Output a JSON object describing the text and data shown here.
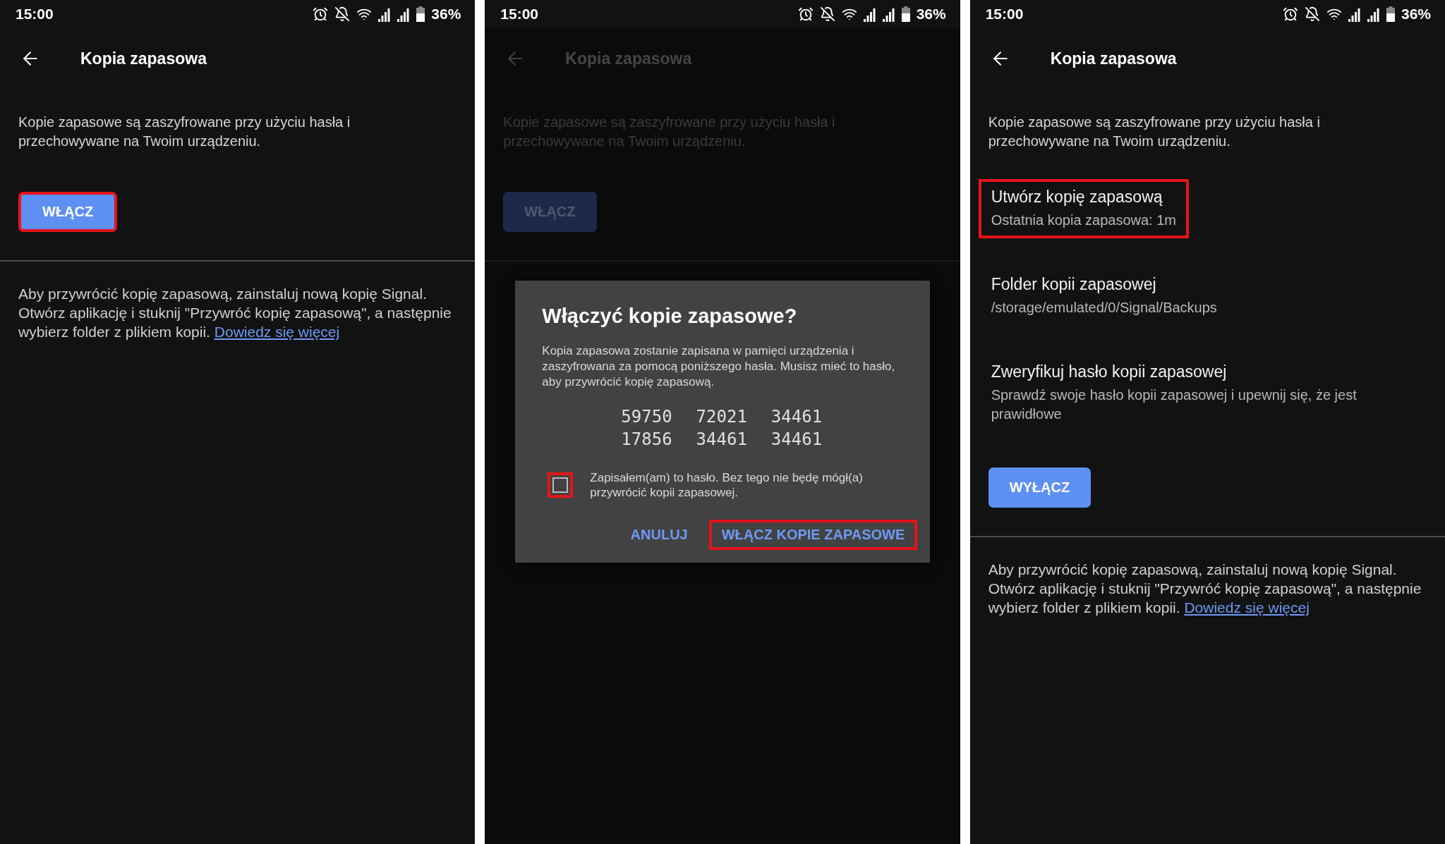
{
  "panels": [
    {
      "status_bar": {
        "time": "15:00",
        "battery": "36%"
      },
      "header": {
        "title": "Kopia zapasowa"
      },
      "dimmed": false,
      "items": [
        {
          "kind": "text",
          "text": "Kopie zapasowe są zaszyfrowane przy użyciu hasła i przechowywane na Twoim urządzeniu."
        },
        {
          "kind": "button",
          "label": "WŁĄCZ",
          "highlighted": true
        },
        {
          "kind": "divider"
        },
        {
          "kind": "note",
          "text": "Aby przywrócić kopię zapasową, zainstaluj nową kopię Signal. Otwórz aplikację i stuknij \"Przywróć kopię zapasową\", a następnie wybierz folder z plikiem kopii.",
          "link": "Dowiedz się więcej"
        }
      ]
    },
    {
      "status_bar": {
        "time": "15:00",
        "battery": "36%"
      },
      "header": {
        "title": "Kopia zapasowa"
      },
      "dimmed": true,
      "items": [
        {
          "kind": "text",
          "text": "Kopie zapasowe są zaszyfrowane przy użyciu hasła i przechowywane na Twoim urządzeniu."
        },
        {
          "kind": "button",
          "label": "WŁĄCZ",
          "highlighted": false
        },
        {
          "kind": "divider"
        }
      ],
      "dialog": {
        "title": "Włączyć kopie zapasowe?",
        "body": "Kopia zapasowa zostanie zapisana w pamięci urządzenia i zaszyfrowana za pomocą poniższego hasła. Musisz mieć to hasło, aby przywrócić kopię zapasową.",
        "passphrase": [
          [
            "59750",
            "72021",
            "34461"
          ],
          [
            "17856",
            "34461",
            "34461"
          ]
        ],
        "checkbox": {
          "label": "Zapisałem(am) to hasło. Bez tego nie będę mógł(a) przywrócić kopii zapasowej.",
          "checked": false,
          "highlighted": true
        },
        "actions": [
          {
            "label": "ANULUJ",
            "highlighted": false
          },
          {
            "label": "WŁĄCZ KOPIE ZAPASOWE",
            "highlighted": true
          }
        ]
      }
    },
    {
      "status_bar": {
        "time": "15:00",
        "battery": "36%"
      },
      "header": {
        "title": "Kopia zapasowa"
      },
      "dimmed": false,
      "items": [
        {
          "kind": "text",
          "text": "Kopie zapasowe są zaszyfrowane przy użyciu hasła i przechowywane na Twoim urządzeniu."
        },
        {
          "kind": "setting",
          "title": "Utwórz kopię zapasową",
          "subtitle": "Ostatnia kopia zapasowa: 1m",
          "highlighted": true
        },
        {
          "kind": "setting",
          "title": "Folder kopii zapasowej",
          "subtitle": "/storage/emulated/0/Signal/Backups",
          "highlighted": false
        },
        {
          "kind": "setting",
          "title": "Zweryfikuj hasło kopii zapasowej",
          "subtitle": "Sprawdź swoje hasło kopii zapasowej i upewnij się, że jest prawidłowe",
          "highlighted": false
        },
        {
          "kind": "button",
          "label": "WYŁĄCZ",
          "highlighted": false
        },
        {
          "kind": "divider"
        },
        {
          "kind": "note",
          "text": "Aby przywrócić kopię zapasową, zainstaluj nową kopię Signal. Otwórz aplikację i stuknij \"Przywróć kopię zapasową\", a następnie wybierz folder z plikiem kopii.",
          "link": "Dowiedz się więcej"
        }
      ]
    }
  ]
}
